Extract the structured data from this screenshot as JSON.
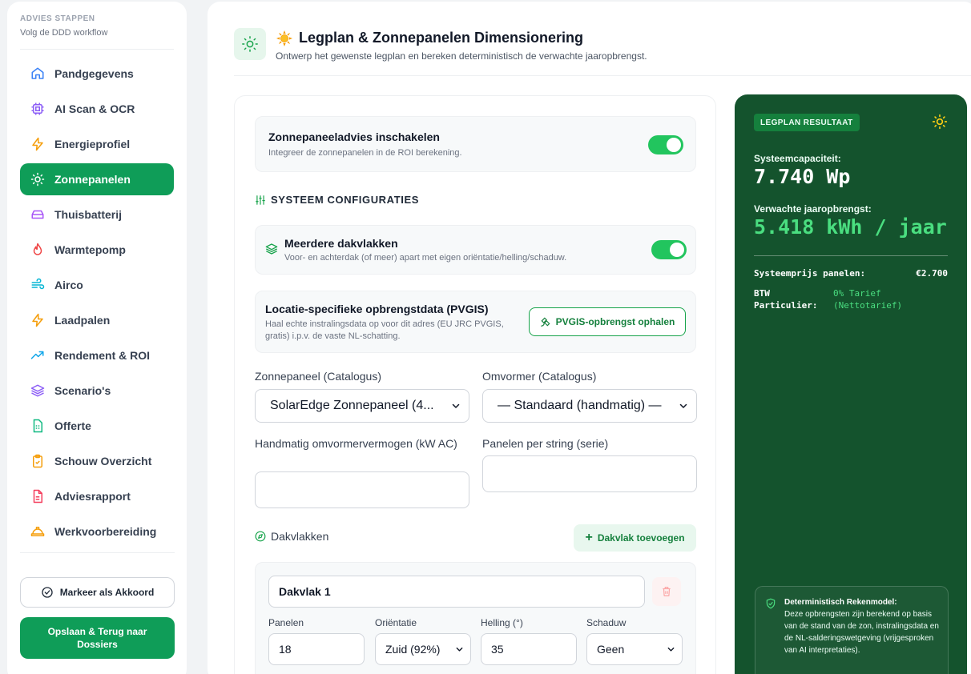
{
  "sidebar": {
    "title": "ADVIES STAPPEN",
    "subtitle": "Volg de DDD workflow",
    "items": [
      {
        "label": "Pandgegevens",
        "icon": "home-icon",
        "color": "#3b82f6"
      },
      {
        "label": "AI Scan & OCR",
        "icon": "cpu-icon",
        "color": "#8b5cf6"
      },
      {
        "label": "Energieprofiel",
        "icon": "lightning-icon",
        "color": "#f59e0b"
      },
      {
        "label": "Zonnepanelen",
        "icon": "sun-icon",
        "color": "#ffffff",
        "active": true
      },
      {
        "label": "Thuisbatterij",
        "icon": "battery-icon",
        "color": "#a855f7"
      },
      {
        "label": "Warmtepomp",
        "icon": "flame-icon",
        "color": "#ef4444"
      },
      {
        "label": "Airco",
        "icon": "wind-icon",
        "color": "#06b6d4"
      },
      {
        "label": "Laadpalen",
        "icon": "lightning-icon",
        "color": "#f59e0b"
      },
      {
        "label": "Rendement & ROI",
        "icon": "trending-up-icon",
        "color": "#0ea5e9"
      },
      {
        "label": "Scenario's",
        "icon": "layers-icon",
        "color": "#8b5cf6"
      },
      {
        "label": "Offerte",
        "icon": "calculator-icon",
        "color": "#10b981"
      },
      {
        "label": "Schouw Overzicht",
        "icon": "clipboard-check-icon",
        "color": "#f59e0b"
      },
      {
        "label": "Adviesrapport",
        "icon": "file-text-icon",
        "color": "#f43f5e"
      },
      {
        "label": "Werkvoorbereiding",
        "icon": "hard-hat-icon",
        "color": "#f59e0b"
      }
    ],
    "approve_label": "Markeer als Akkoord",
    "save_label": "Opslaan & Terug naar Dossiers"
  },
  "header": {
    "title": "Legplan & Zonnepanelen Dimensionering",
    "subtitle": "Ontwerp het gewenste legplan en bereken deterministisch de verwachte jaaropbrengst."
  },
  "config": {
    "enable_title": "Zonnepaneeladvies inschakelen",
    "enable_sub": "Integreer de zonnepanelen in de ROI berekening.",
    "enable_on": true,
    "section_title": "SYSTEEM CONFIGURATIES",
    "multi_title": "Meerdere dakvlakken",
    "multi_sub": "Voor- en achterdak (of meer) apart met eigen oriëntatie/helling/schaduw.",
    "multi_on": true,
    "pvgis_title": "Locatie-specifieke opbrengstdata (PVGIS)",
    "pvgis_sub": "Haal echte instralingsdata op voor dit adres (EU JRC PVGIS, gratis) i.p.v. de vaste NL-schatting.",
    "pvgis_button": "PVGIS-opbrengst ophalen",
    "panel_label": "Zonnepaneel (Catalogus)",
    "panel_value": "SolarEdge Zonnepaneel (4...",
    "inverter_label": "Omvormer (Catalogus)",
    "inverter_value": "— Standaard (handmatig) —",
    "manual_label": "Handmatig omvormervermogen (kW AC)",
    "manual_value": "",
    "string_label": "Panelen per string (serie)",
    "string_value": ""
  },
  "dakvlakken": {
    "title": "Dakvlakken",
    "add_label": "Dakvlak toevoegen",
    "items": [
      {
        "name": "Dakvlak 1",
        "panelen_label": "Panelen",
        "panelen": "18",
        "orientatie_label": "Oriëntatie",
        "orientatie": "Zuid (92%)",
        "helling_label": "Helling (°)",
        "helling": "35",
        "schaduw_label": "Schaduw",
        "schaduw": "Geen"
      }
    ]
  },
  "result": {
    "badge": "LEGPLAN RESULTAAT",
    "cap_label": "Systeemcapaciteit:",
    "cap_value": "7.740 Wp",
    "yield_label": "Verwachte jaaropbrengst:",
    "yield_value": "5.418 kWh / jaar",
    "price_label": "Systeemprijs panelen:",
    "price_value": "€2.700",
    "btw_label_1": "BTW",
    "btw_label_2": "Particulier:",
    "btw_value_1": "0% Tarief",
    "btw_value_2": "(Nettotarief)",
    "det_title": "Deterministisch Rekenmodel:",
    "det_body": "Deze opbrengsten zijn berekend op basis van de stand van de zon, instralingsdata en de NL-salderingswetgeving (vrijgesproken van AI interpretaties).",
    "accent_color": "#4ade80"
  }
}
